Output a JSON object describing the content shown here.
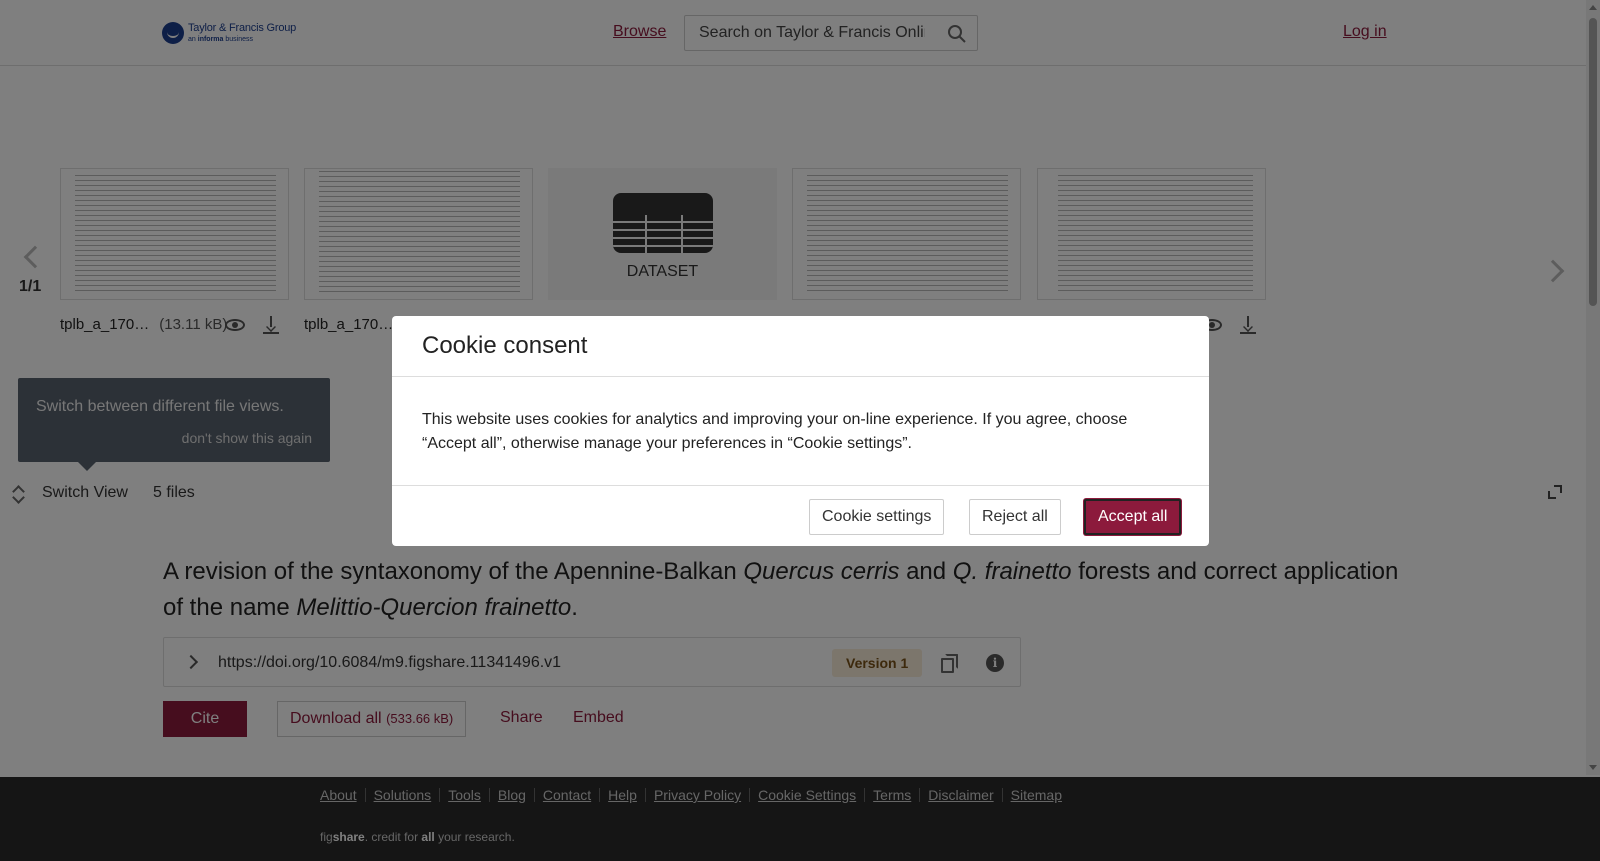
{
  "header": {
    "logo_name": "Taylor & Francis Group",
    "logo_sub_prefix": "an",
    "logo_sub_brand": "informa",
    "logo_sub_suffix": "business",
    "browse_label": "Browse",
    "search_placeholder": "Search on Taylor & Francis Online",
    "login_label": "Log in"
  },
  "viewer": {
    "page_count": "1/1",
    "files": [
      {
        "name": "tplb_a_170…",
        "size": "(13.11 kB)"
      },
      {
        "name": "tplb_a_170…"
      },
      {
        "label": "DATASET"
      }
    ],
    "tooltip_text": "Switch between different file views.",
    "tooltip_dismiss": "don't show this again",
    "switch_view_label": "Switch View",
    "files_count": "5 files"
  },
  "item": {
    "title_parts": [
      "A revision of the syntaxonomy of the Apennine-Balkan ",
      "Quercus cerris",
      " and ",
      "Q. frainetto",
      " forests and correct application of the name ",
      "Melittio-Quercion frainetto",
      "."
    ],
    "doi": "https://doi.org/10.6084/m9.figshare.11341496.v1",
    "version": "Version 1",
    "cite_label": "Cite",
    "download_label": "Download all",
    "download_size": "(533.66 kB)",
    "share_label": "Share",
    "embed_label": "Embed"
  },
  "footer": {
    "links": [
      "About",
      "Solutions",
      "Tools",
      "Blog",
      "Contact",
      "Help",
      "Privacy Policy",
      "Cookie Settings",
      "Terms",
      "Disclaimer",
      "Sitemap"
    ],
    "tagline_fig": "fig",
    "tagline_share": "share",
    "tagline_mid": ". credit for ",
    "tagline_all": "all",
    "tagline_end": " your research."
  },
  "cookie": {
    "title": "Cookie consent",
    "body": "This website uses cookies for analytics and improving your on-line experience. If you agree, choose “Accept all”, otherwise manage your preferences in “Cookie settings”.",
    "settings_label": "Cookie settings",
    "reject_label": "Reject all",
    "accept_label": "Accept all"
  },
  "colors": {
    "brand": "#8c1a3c",
    "footer_bg": "#2a2a2a",
    "version_bg": "#f8ecd9"
  }
}
